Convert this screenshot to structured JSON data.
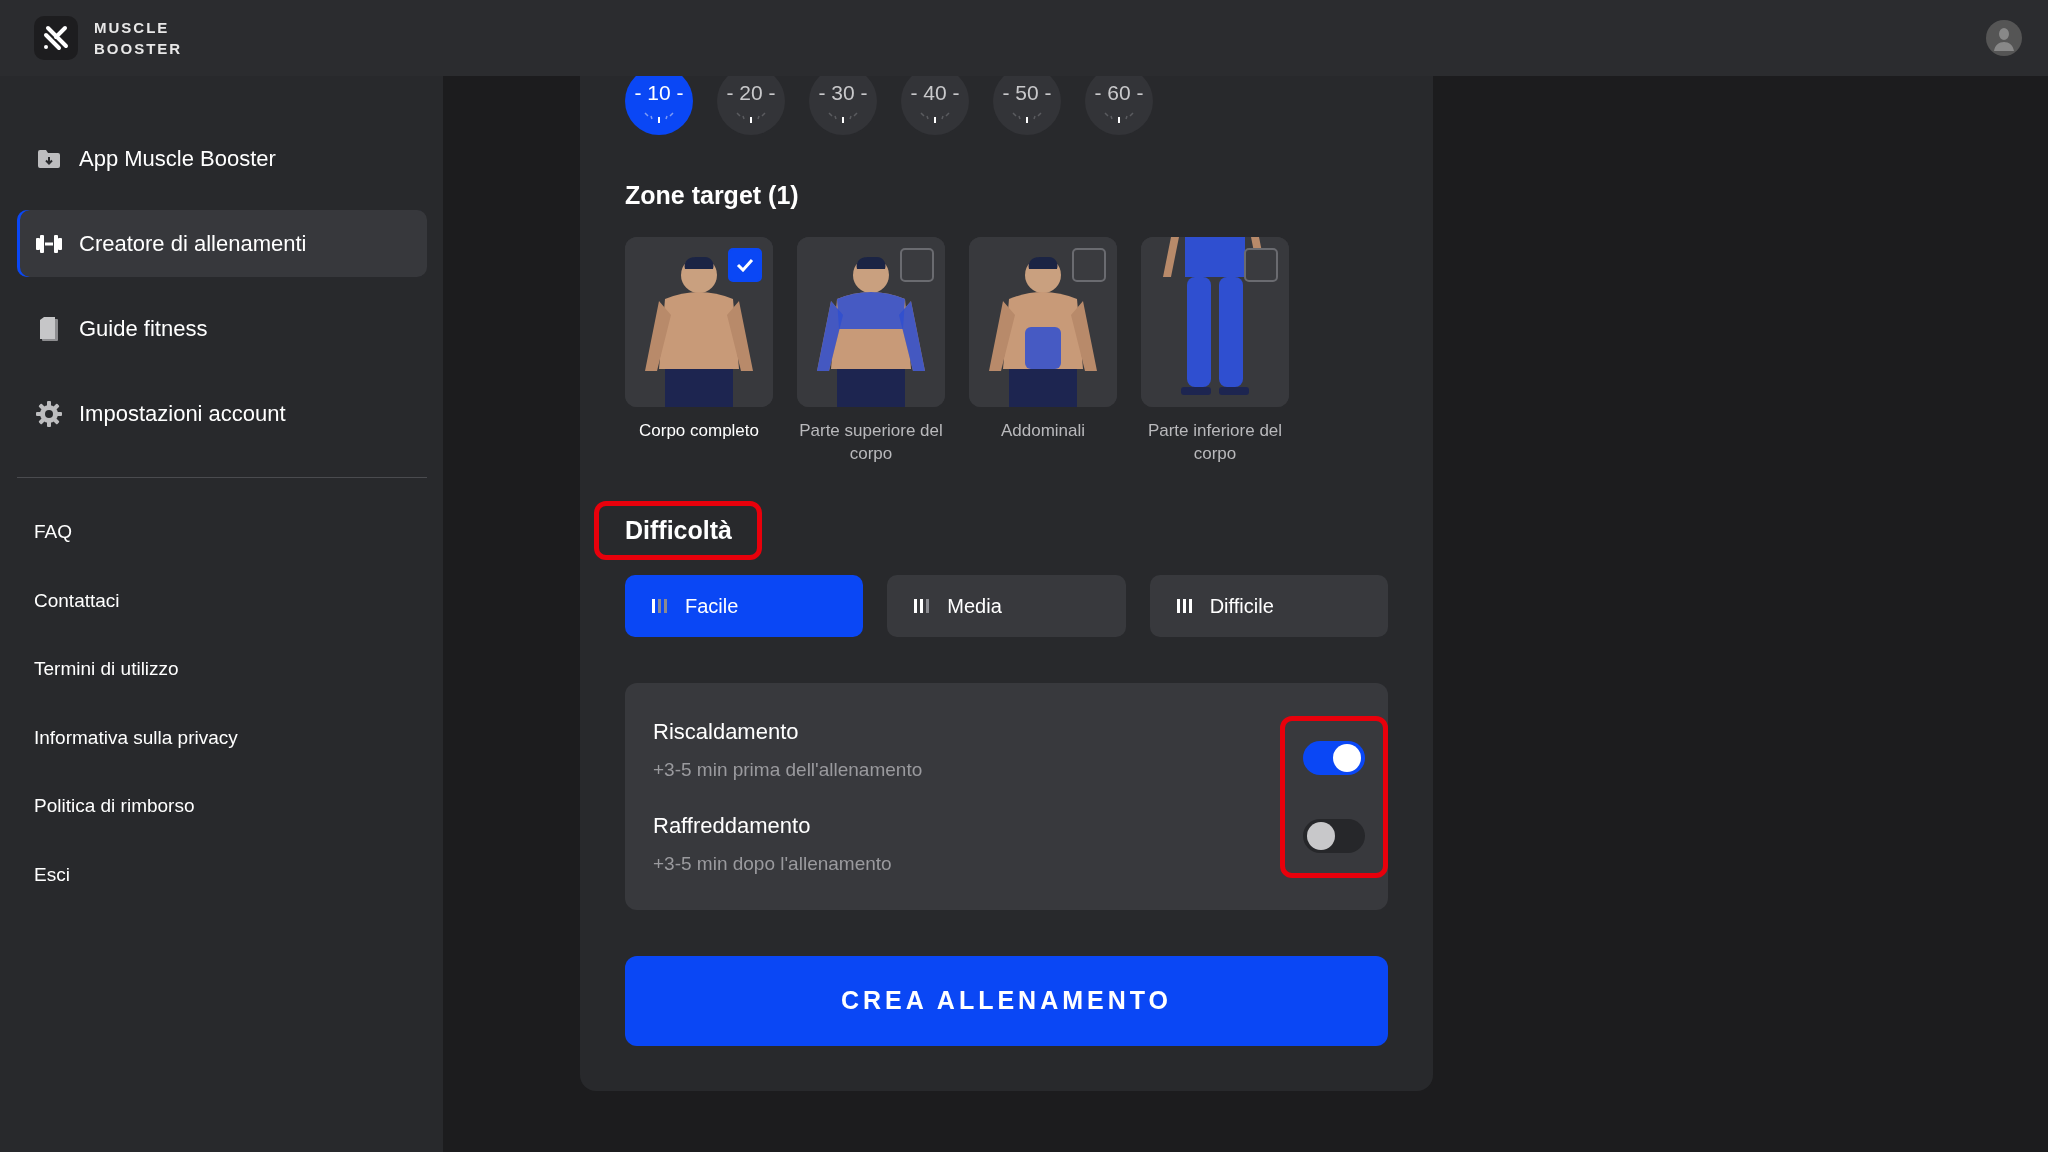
{
  "header": {
    "logo_lines": [
      "MUSCLE",
      "BOOSTER"
    ]
  },
  "sidebar": {
    "items": [
      {
        "label": "App Muscle Booster",
        "kind": "download",
        "selected": false
      },
      {
        "label": "Creatore di allenamenti",
        "kind": "dumbbell",
        "selected": true
      },
      {
        "label": "Guide fitness",
        "kind": "document",
        "selected": false
      },
      {
        "label": "Impostazioni account",
        "kind": "gear",
        "selected": false
      }
    ],
    "links": [
      "FAQ",
      "Contattaci",
      "Termini di utilizzo",
      "Informativa sulla privacy",
      "Politica di rimborso",
      "Esci"
    ]
  },
  "duration": {
    "options": [
      {
        "label": "- 10 -",
        "selected": true
      },
      {
        "label": "- 20 -",
        "selected": false
      },
      {
        "label": "- 30 -",
        "selected": false
      },
      {
        "label": "- 40 -",
        "selected": false
      },
      {
        "label": "- 50 -",
        "selected": false
      },
      {
        "label": "- 60 -",
        "selected": false
      }
    ]
  },
  "zones": {
    "title": "Zone target (1)",
    "items": [
      {
        "label": "Corpo completo",
        "selected": true
      },
      {
        "label": "Parte superiore del corpo",
        "selected": false
      },
      {
        "label": "Addominali",
        "selected": false
      },
      {
        "label": "Parte inferiore del corpo",
        "selected": false
      }
    ]
  },
  "difficulty": {
    "title": "Difficoltà",
    "highlighted": true,
    "options": [
      {
        "label": "Facile",
        "kind": "easy",
        "selected": true
      },
      {
        "label": "Media",
        "kind": "medium",
        "selected": false
      },
      {
        "label": "Difficile",
        "kind": "hard",
        "selected": false
      }
    ]
  },
  "extras": {
    "highlighted": true,
    "items": [
      {
        "title": "Riscaldamento",
        "subtitle": "+3-5 min prima dell'allenamento",
        "on": true
      },
      {
        "title": "Raffreddamento",
        "subtitle": "+3-5 min dopo l'allenamento",
        "on": false
      }
    ]
  },
  "create_button": "CREA ALLENAMENTO"
}
